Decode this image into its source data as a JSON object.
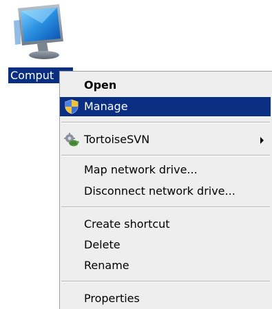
{
  "desktop": {
    "icon_name": "computer-icon",
    "label": "Comput"
  },
  "context_menu": {
    "items": [
      {
        "label": "Open",
        "bold": true
      },
      {
        "label": "Manage",
        "selected": true,
        "icon": "uac-shield-icon"
      },
      {
        "label": "TortoiseSVN",
        "icon": "tortoisesvn-icon",
        "submenu": true
      },
      {
        "label": "Map network drive..."
      },
      {
        "label": "Disconnect network drive..."
      },
      {
        "label": "Create shortcut"
      },
      {
        "label": "Delete"
      },
      {
        "label": "Rename"
      },
      {
        "label": "Properties"
      }
    ]
  },
  "colors": {
    "selection": "#0a2e82",
    "menu_background": "#eeeeee"
  }
}
